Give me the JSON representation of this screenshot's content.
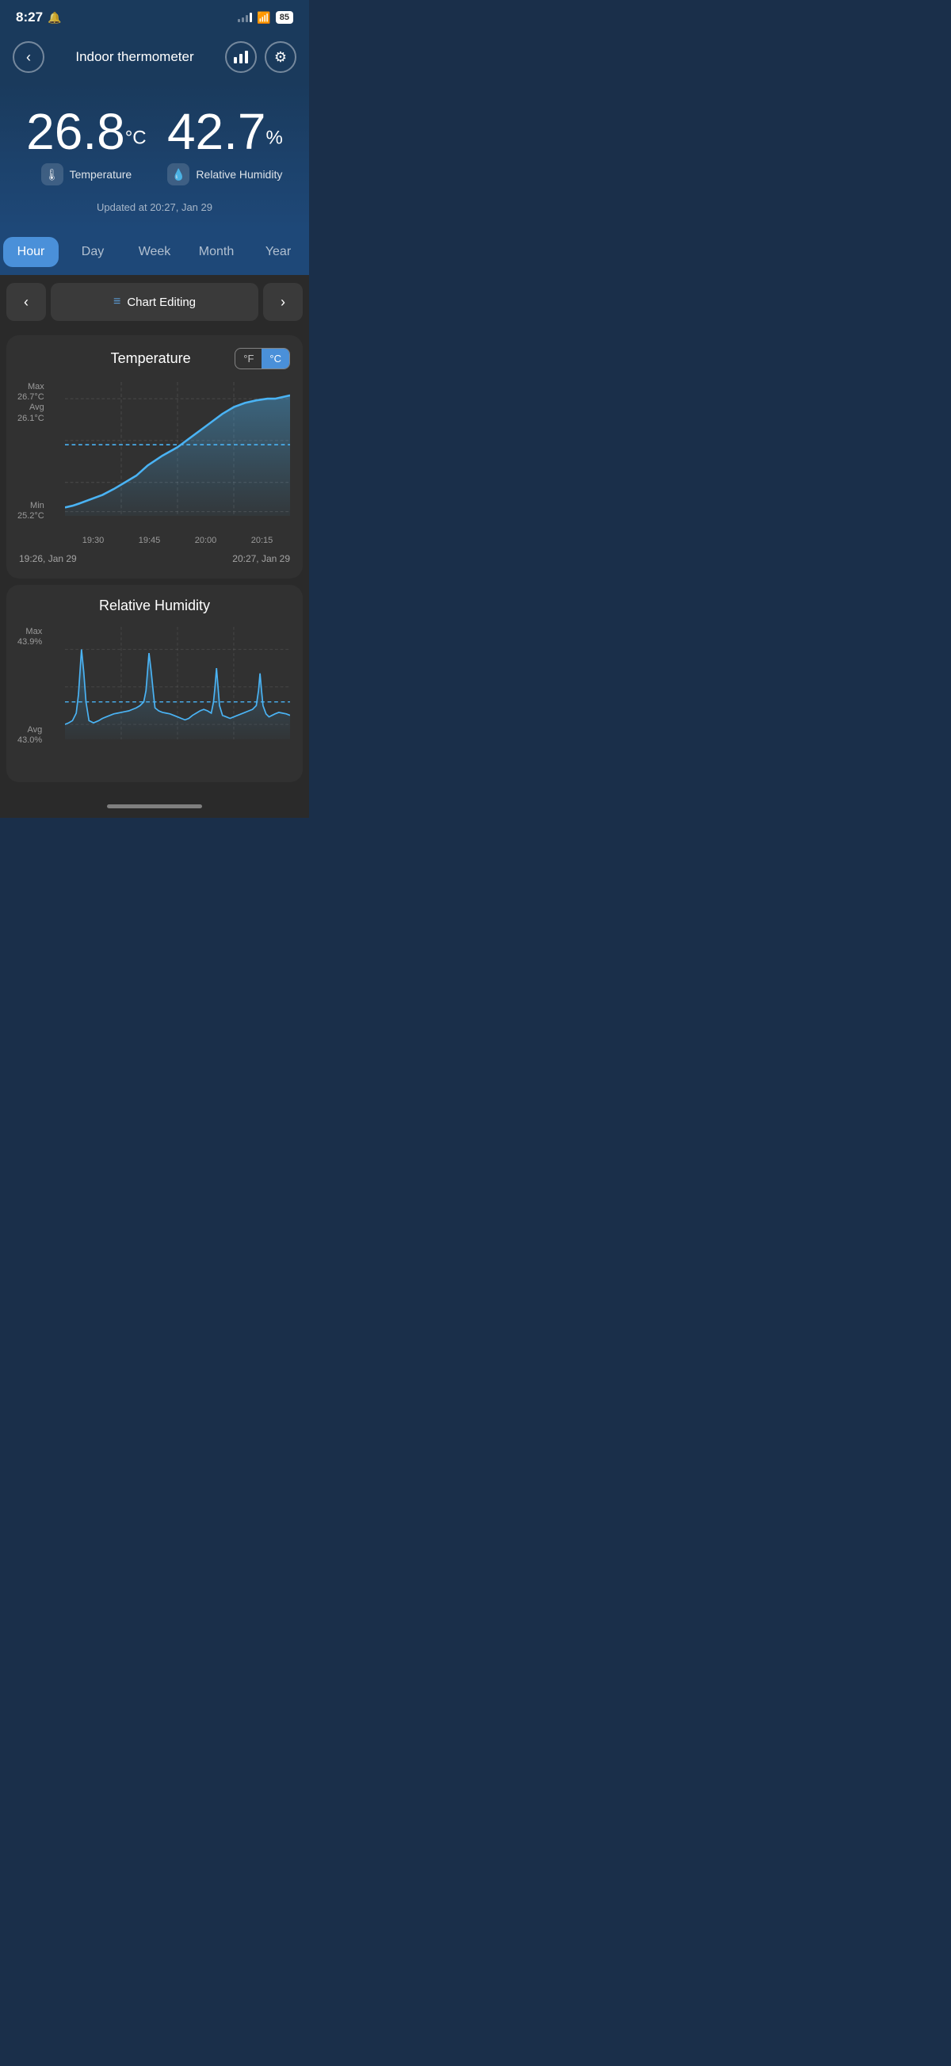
{
  "statusBar": {
    "time": "8:27",
    "battery": "85"
  },
  "header": {
    "title": "Indoor thermometer",
    "backLabel": "‹",
    "chartLabel": "📊",
    "settingsLabel": "⚙"
  },
  "readings": {
    "temperature": {
      "value": "26.8",
      "unit": "°C",
      "label": "Temperature",
      "icon": "🌡"
    },
    "humidity": {
      "value": "42.7",
      "unit": "%",
      "label": "Relative Humidity",
      "icon": "💧"
    },
    "updatedAt": "Updated at 20:27,  Jan 29"
  },
  "tabs": [
    {
      "id": "hour",
      "label": "Hour",
      "active": true
    },
    {
      "id": "day",
      "label": "Day",
      "active": false
    },
    {
      "id": "week",
      "label": "Week",
      "active": false
    },
    {
      "id": "month",
      "label": "Month",
      "active": false
    },
    {
      "id": "year",
      "label": "Year",
      "active": false
    }
  ],
  "chartHeader": {
    "editLabel": "Chart Editing"
  },
  "temperatureChart": {
    "title": "Temperature",
    "unitF": "°F",
    "unitC": "°C",
    "maxLabel": "Max",
    "maxValue": "26.7°C",
    "avgLabel": "Avg",
    "avgValue": "26.1°C",
    "minLabel": "Min",
    "minValue": "25.2°C",
    "xLabels": [
      "19:30",
      "19:45",
      "20:00",
      "20:15"
    ],
    "startDate": "19:26,  Jan 29",
    "endDate": "20:27,  Jan 29"
  },
  "humidityChart": {
    "title": "Relative Humidity",
    "maxLabel": "Max",
    "maxValue": "43.9%",
    "avgLabel": "Avg",
    "avgValue": "43.0%"
  }
}
